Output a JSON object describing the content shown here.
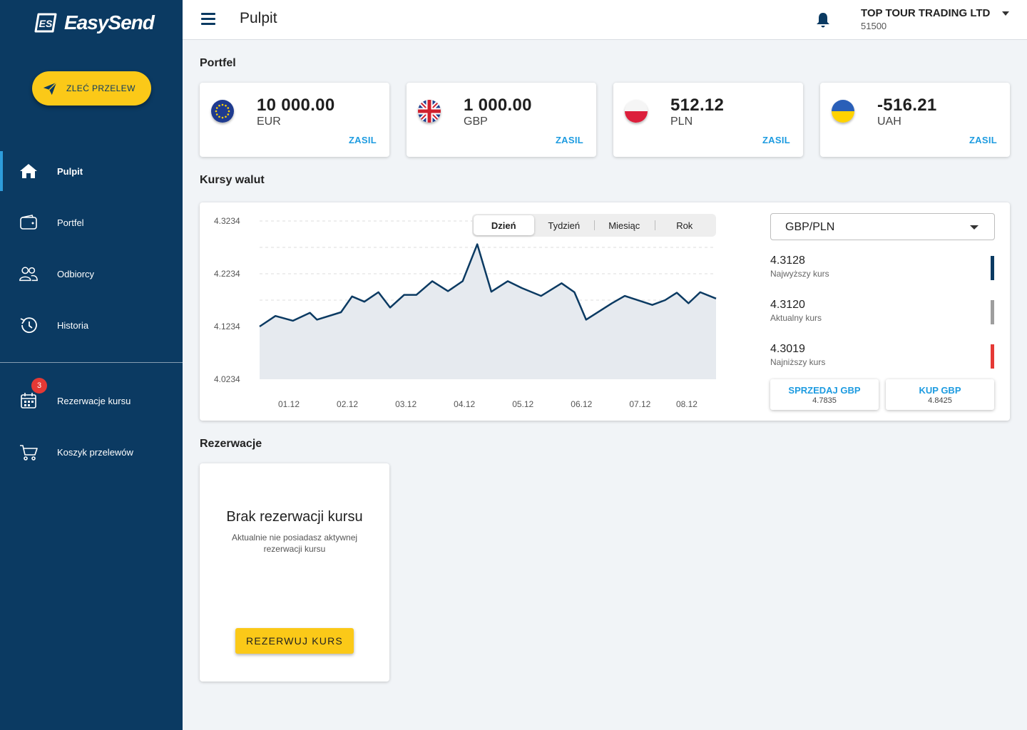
{
  "brand": {
    "name": "EasySend",
    "logo_initials": "ES"
  },
  "sidebar": {
    "cta_label": "ZLEĆ PRZELEW",
    "items": [
      {
        "label": "Pulpit",
        "icon": "home-icon",
        "active": true
      },
      {
        "label": "Portfel",
        "icon": "wallet-icon",
        "active": false
      },
      {
        "label": "Odbiorcy",
        "icon": "users-icon",
        "active": false
      },
      {
        "label": "Historia",
        "icon": "history-icon",
        "active": false
      }
    ],
    "secondary_items": [
      {
        "label": "Rezerwacje kursu",
        "icon": "calendar-icon",
        "badge": "3"
      },
      {
        "label": "Koszyk przelewów",
        "icon": "cart-icon"
      }
    ]
  },
  "topbar": {
    "title": "Pulpit",
    "company_name": "TOP TOUR TRADING LTD",
    "company_id": "51500"
  },
  "wallet": {
    "heading": "Portfel",
    "cards": [
      {
        "amount": "10 000.00",
        "currency": "EUR",
        "flag": "eu-flag-icon",
        "action": "ZASIL"
      },
      {
        "amount": "1 000.00",
        "currency": "GBP",
        "flag": "uk-flag-icon",
        "action": "ZASIL"
      },
      {
        "amount": "512.12",
        "currency": "PLN",
        "flag": "pl-flag-icon",
        "action": "ZASIL"
      },
      {
        "amount": "-516.21",
        "currency": "UAH",
        "flag": "ua-flag-icon",
        "action": "ZASIL"
      }
    ]
  },
  "rates": {
    "heading": "Kursy walut",
    "tabs": [
      "Dzień",
      "Tydzień",
      "Miesiąc",
      "Rok"
    ],
    "active_tab": "Dzień",
    "pair": "GBP/PLN",
    "stats": [
      {
        "value": "4.3128",
        "label": "Najwyższy kurs",
        "color": "#0b3a62"
      },
      {
        "value": "4.3120",
        "label": "Aktualny kurs",
        "color": "#9e9e9e"
      },
      {
        "value": "4.3019",
        "label": "Najniższy kurs",
        "color": "#e53935"
      }
    ],
    "sell": {
      "label": "SPRZEDAJ GBP",
      "rate": "4.7835"
    },
    "buy": {
      "label": "KUP GBP",
      "rate": "4.8425"
    }
  },
  "chart_data": {
    "type": "area",
    "title": "",
    "xlabel": "",
    "ylabel": "",
    "ylim": [
      4.0234,
      4.3234
    ],
    "yticks": [
      4.3234,
      4.2234,
      4.1234,
      4.0234
    ],
    "x_ticks": [
      {
        "label": "01.12",
        "x": 0.5
      },
      {
        "label": "02.12",
        "x": 1.5
      },
      {
        "label": "03.12",
        "x": 2.5
      },
      {
        "label": "04.12",
        "x": 3.5
      },
      {
        "label": "05.12",
        "x": 4.5
      },
      {
        "label": "06.12",
        "x": 5.5
      },
      {
        "label": "07.12",
        "x": 6.5
      },
      {
        "label": "08.12",
        "x": 7.3
      }
    ],
    "xlim": [
      0,
      7.8
    ],
    "grid": true,
    "series": [
      {
        "line_color": "#0b3a62",
        "fill_color": "#e6eaef",
        "x": [
          0,
          0.27,
          0.57,
          0.86,
          0.98,
          1.39,
          1.58,
          1.79,
          2.03,
          2.23,
          2.47,
          2.68,
          2.95,
          3.22,
          3.47,
          3.72,
          3.96,
          4.24,
          4.48,
          4.81,
          5.16,
          5.38,
          5.58,
          6.02,
          6.24,
          6.71,
          6.93,
          7.13,
          7.33,
          7.53,
          7.8
        ],
        "y": [
          4.1234,
          4.1434,
          4.1344,
          4.1494,
          4.1364,
          4.1504,
          4.1804,
          4.1704,
          4.1884,
          4.1594,
          4.1834,
          4.1834,
          4.2094,
          4.1904,
          4.2094,
          4.2794,
          4.1894,
          4.2094,
          4.1964,
          4.1814,
          4.2054,
          4.1884,
          4.1364,
          4.1674,
          4.1814,
          4.1644,
          4.1734,
          4.1874,
          4.1674,
          4.1884,
          4.1764
        ]
      }
    ]
  },
  "reservations": {
    "heading": "Rezerwacje",
    "empty_title": "Brak rezerwacji kursu",
    "empty_subtitle": "Aktualnie nie posiadasz aktywnej rezerwacji kursu",
    "button": "REZERWUJ KURS"
  }
}
